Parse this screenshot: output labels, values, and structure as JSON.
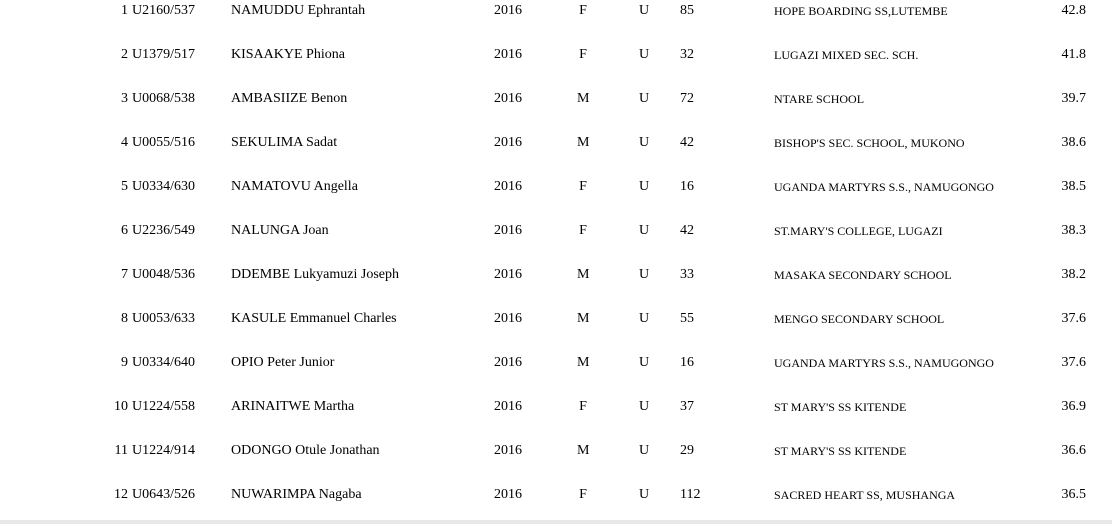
{
  "rows": [
    {
      "num": "1",
      "index": "U2160/537",
      "name": "NAMUDDU Ephrantah",
      "year": "2016",
      "sex": "F",
      "cat": "U",
      "count": "85",
      "school": "HOPE BOARDING SS,LUTEMBE",
      "score": "42.8"
    },
    {
      "num": "2",
      "index": "U1379/517",
      "name": "KISAAKYE Phiona",
      "year": "2016",
      "sex": "F",
      "cat": "U",
      "count": "32",
      "school": "LUGAZI MIXED SEC. SCH.",
      "score": "41.8"
    },
    {
      "num": "3",
      "index": "U0068/538",
      "name": "AMBASIIZE Benon",
      "year": "2016",
      "sex": "M",
      "cat": "U",
      "count": "72",
      "school": "NTARE SCHOOL",
      "score": "39.7"
    },
    {
      "num": "4",
      "index": "U0055/516",
      "name": "SEKULIMA Sadat",
      "year": "2016",
      "sex": "M",
      "cat": "U",
      "count": "42",
      "school": "BISHOP'S SEC. SCHOOL, MUKONO",
      "score": "38.6"
    },
    {
      "num": "5",
      "index": "U0334/630",
      "name": "NAMATOVU Angella",
      "year": "2016",
      "sex": "F",
      "cat": "U",
      "count": "16",
      "school": "UGANDA MARTYRS S.S., NAMUGONGO",
      "score": "38.5"
    },
    {
      "num": "6",
      "index": "U2236/549",
      "name": "NALUNGA Joan",
      "year": "2016",
      "sex": "F",
      "cat": "U",
      "count": "42",
      "school": "ST.MARY'S COLLEGE, LUGAZI",
      "score": "38.3"
    },
    {
      "num": "7",
      "index": "U0048/536",
      "name": "DDEMBE Lukyamuzi Joseph",
      "year": "2016",
      "sex": "M",
      "cat": "U",
      "count": "33",
      "school": "MASAKA SECONDARY SCHOOL",
      "score": "38.2"
    },
    {
      "num": "8",
      "index": "U0053/633",
      "name": "KASULE Emmanuel Charles",
      "year": "2016",
      "sex": "M",
      "cat": "U",
      "count": "55",
      "school": "MENGO SECONDARY SCHOOL",
      "score": "37.6"
    },
    {
      "num": "9",
      "index": "U0334/640",
      "name": "OPIO Peter Junior",
      "year": "2016",
      "sex": "M",
      "cat": "U",
      "count": "16",
      "school": "UGANDA MARTYRS S.S., NAMUGONGO",
      "score": "37.6"
    },
    {
      "num": "10",
      "index": "U1224/558",
      "name": "ARINAITWE Martha",
      "year": "2016",
      "sex": "F",
      "cat": "U",
      "count": "37",
      "school": "ST MARY'S SS  KITENDE",
      "score": "36.9"
    },
    {
      "num": "11",
      "index": "U1224/914",
      "name": "ODONGO Otule Jonathan",
      "year": "2016",
      "sex": "M",
      "cat": "U",
      "count": "29",
      "school": "ST MARY'S SS  KITENDE",
      "score": "36.6"
    },
    {
      "num": "12",
      "index": "U0643/526",
      "name": "NUWARIMPA Nagaba",
      "year": "2016",
      "sex": "F",
      "cat": "U",
      "count": "112",
      "school": "SACRED HEART SS, MUSHANGA",
      "score": "36.5"
    }
  ]
}
